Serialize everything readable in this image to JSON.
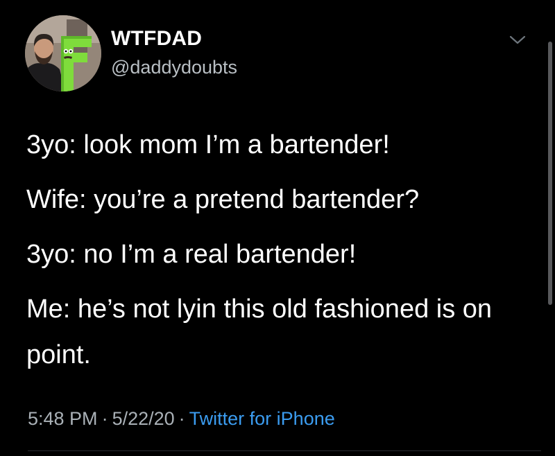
{
  "tweet": {
    "author": {
      "display_name": "WTFDAD",
      "handle": "@daddydoubts",
      "avatar_icon": "avatar-photo-man-with-green-letter-f"
    },
    "menu_icon": "chevron-down-icon",
    "lines": [
      "3yo: look mom I’m a bartender!",
      "Wife: you’re a pretend bartender?",
      "3yo: no I’m a real bartender!",
      "Me: he’s not lyin this old fashioned is on point."
    ],
    "time": "5:48 PM",
    "date": "5/22/20",
    "separator": "·",
    "source": "Twitter for iPhone"
  },
  "colors": {
    "background": "#000000",
    "text": "#ffffff",
    "secondary_text": "#aab1b7",
    "link": "#3b9cf0",
    "avatar_letter_green": "#7fdc3c"
  }
}
